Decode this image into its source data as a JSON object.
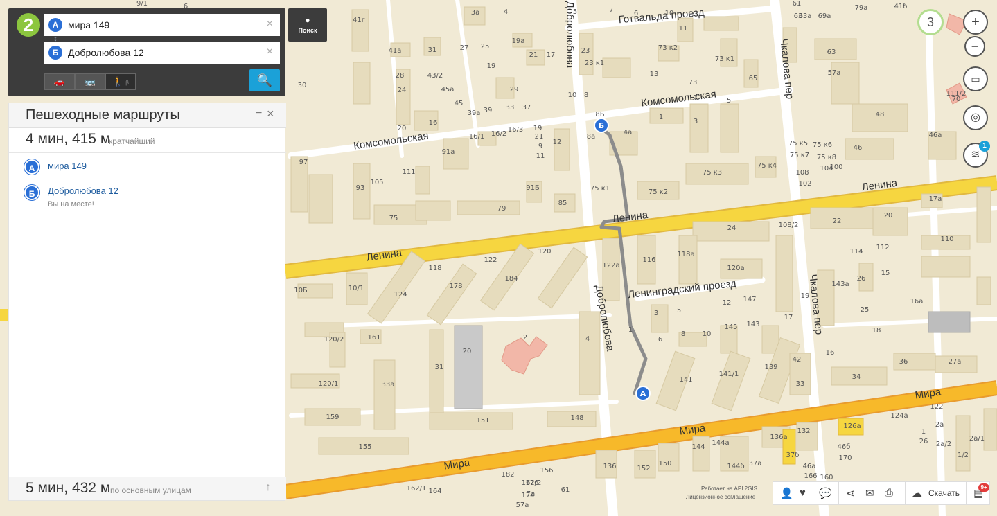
{
  "brand": {
    "logo_text": "2"
  },
  "search": {
    "from": {
      "letter": "A",
      "value": "мира 149"
    },
    "to": {
      "letter": "Б",
      "value": "Добролюбова 12"
    },
    "clear_icon": "×",
    "swap_icon": "↕",
    "modes": [
      {
        "icon": "car-icon",
        "glyph": "🚗",
        "active": false
      },
      {
        "icon": "bus-icon",
        "glyph": "🚌",
        "active": false
      },
      {
        "icon": "walk-icon",
        "glyph": "🚶",
        "active": true,
        "beta": "β"
      }
    ],
    "go_icon": "🔍"
  },
  "poisk": {
    "label": "Поиск",
    "icon": "pin-icon"
  },
  "panel": {
    "title": "Пешеходные маршруты",
    "minimize_icon": "−",
    "close_icon": "×",
    "route": {
      "time_dist": "4 мин, 415 м",
      "note": "кратчайший"
    },
    "stops": [
      {
        "letter": "A",
        "name": "мира 149",
        "note": ""
      },
      {
        "letter": "Б",
        "name": "Добролюбова 12",
        "note": "Вы на месте!"
      }
    ],
    "alt": {
      "time_dist": "5 мин, 432 м",
      "note": "по основным улицам",
      "icon": "↑"
    }
  },
  "controls": {
    "zoom_level": "3",
    "plus": "+",
    "minus": "−",
    "ruler": "▭",
    "locate": "◎",
    "layers": "≋",
    "layers_badge": "1"
  },
  "toolbar": {
    "icons": [
      "person-icon",
      "heart-icon",
      "chat-icon",
      "share-icon",
      "mail-icon",
      "print-icon",
      "download-icon"
    ],
    "download_label": "Скачать",
    "news_badge": "9+"
  },
  "attribution": {
    "line1": "Работает на API 2GIS",
    "line2": "Лицензионное соглашение"
  },
  "map": {
    "colors": {
      "base": "#f1ead5",
      "building": "#e6dcbd",
      "road": "#ffffff",
      "main_road": "#f6d640",
      "route": "#8c8c8c"
    },
    "streets": [
      {
        "name": "Готвальда проезд"
      },
      {
        "name": "Комсомольская"
      },
      {
        "name": "Комсомольская"
      },
      {
        "name": "Ленина"
      },
      {
        "name": "Ленина"
      },
      {
        "name": "Ленина"
      },
      {
        "name": "Ленинградский проезд"
      },
      {
        "name": "Мира"
      },
      {
        "name": "Мира"
      },
      {
        "name": "Мира"
      },
      {
        "name": "Добролюбова"
      },
      {
        "name": "Добролюбова"
      },
      {
        "name": "Чкалова пер"
      },
      {
        "name": "Чкалова пер"
      }
    ],
    "house_numbers": [
      "9/1",
      "6",
      "3а",
      "4",
      "5",
      "7",
      "6",
      "10",
      "11",
      "61",
      "63",
      "63а",
      "69а",
      "79а",
      "41б",
      "41г",
      "41а",
      "31",
      "27",
      "25",
      "19",
      "19а",
      "21",
      "17",
      "23",
      "23 к1",
      "29",
      "33",
      "37",
      "39",
      "39а",
      "45",
      "45а",
      "43/2",
      "28",
      "24",
      "20",
      "16",
      "16/1",
      "16/2",
      "16/3",
      "19",
      "21",
      "9",
      "11",
      "12",
      "10",
      "8",
      "8а",
      "8Б",
      "4а",
      "1",
      "3",
      "5",
      "7",
      "13",
      "73 к2",
      "73",
      "73 к1",
      "65",
      "63",
      "57а",
      "48",
      "46",
      "46а",
      "111/2",
      "30",
      "97",
      "93",
      "105",
      "111",
      "91а",
      "91Б",
      "85",
      "79",
      "75",
      "75 к1",
      "75 к2",
      "75 к3",
      "75 к4",
      "75 к5",
      "75 к6",
      "75 к7",
      "75 к8",
      "108",
      "104",
      "102",
      "100",
      "24",
      "22",
      "20",
      "17а",
      "110",
      "112",
      "114",
      "108/2",
      "118а",
      "116",
      "122а",
      "120а",
      "120",
      "118",
      "122",
      "178",
      "184",
      "124",
      "10/1",
      "10Б",
      "161",
      "120/2",
      "120/1",
      "33а",
      "31",
      "20",
      "2",
      "4",
      "1",
      "3",
      "5",
      "6",
      "8",
      "10",
      "12",
      "147",
      "145",
      "143",
      "143а",
      "141",
      "141/1",
      "139",
      "33",
      "34",
      "36",
      "27а",
      "42",
      "19",
      "17",
      "16",
      "18",
      "25",
      "26",
      "15",
      "16а",
      "159",
      "155",
      "151",
      "148",
      "150",
      "152",
      "136",
      "136а",
      "132",
      "126а",
      "124а",
      "122",
      "2а",
      "2а/1",
      "2а/2",
      "1/2",
      "1",
      "26",
      "144",
      "144а",
      "144б",
      "37а",
      "37б",
      "46а",
      "46б",
      "170",
      "166",
      "162",
      "160",
      "156",
      "176",
      "174",
      "182",
      "162/2",
      "162/1",
      "164",
      "7а",
      "57а",
      "61",
      "70"
    ]
  }
}
